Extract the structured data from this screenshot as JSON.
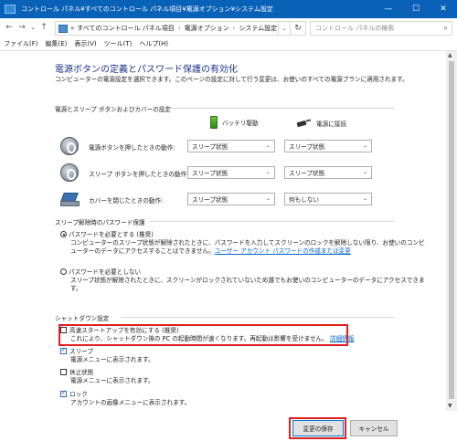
{
  "window": {
    "title": "コントロール パネル¥すべてのコントロール パネル項目¥電源オプション¥システム設定",
    "minimize": "—",
    "maximize": "☐",
    "close": "✕"
  },
  "address": {
    "back": "←",
    "forward": "→",
    "recent": "⌄",
    "up": "↑",
    "overflow": "«",
    "crumbs": [
      "すべてのコントロール パネル項目",
      "電源オプション",
      "システム設定"
    ],
    "crumb_sep": "›",
    "dropdown": "⌄",
    "refresh": "↻",
    "search_placeholder": "コントロール パネルの検索",
    "search_icon": "⌕"
  },
  "menu": [
    "ファイル(F)",
    "編集(E)",
    "表示(V)",
    "ツール(T)",
    "ヘルプ(H)"
  ],
  "page": {
    "title": "電源ボタンの定義とパスワード保護の有効化",
    "description": "コンピューターの電源設定を選択できます。このページの設定に対して行う変更は、お使いのすべての電源プランに適用されます。"
  },
  "power_section": {
    "title": "電源とスリープ ボタンおよびカバーの設定",
    "battery_label": "バッテリ駆動",
    "plugged_label": "電源に接続",
    "rows": [
      {
        "label": "電源ボタンを押したときの動作:",
        "battery": "スリープ状態",
        "plugged": "スリープ状態",
        "icon": "power-button-icon"
      },
      {
        "label": "スリープ ボタンを押したときの動作:",
        "battery": "スリープ状態",
        "plugged": "スリープ状態",
        "icon": "sleep-button-icon"
      },
      {
        "label": "カバーを閉じたときの動作:",
        "battery": "スリープ状態",
        "plugged": "何もしない",
        "icon": "laptop-lid-icon"
      }
    ],
    "chevron": "⌄"
  },
  "password_section": {
    "title": "スリープ解除時のパスワード保護",
    "option_require": "パスワードを必要とする (推奨)",
    "option_require_desc": "コンピューターのスリープ状態が解除されたときに、パスワードを入力してスクリーンのロックを解除しない限り、お使いのコンピューターのデータにアクセスすることはできません。",
    "option_require_link": "ユーザー アカウント パスワードの作成または変更",
    "option_norequire": "パスワードを必要としない",
    "option_norequire_desc": "スリープ状態が解除されたときに、スクリーンがロックされていないため誰でもお使いのコンピューターのデータにアクセスできます。"
  },
  "shutdown_section": {
    "title": "シャットダウン設定",
    "fast_startup": "高速スタートアップを有効にする (推奨)",
    "fast_startup_desc": "これにより、シャットダウン後の PC の起動時間が速くなります。再起動は影響を受けません。",
    "fast_startup_link": "詳細情報",
    "sleep": "スリープ",
    "sleep_desc": "電源メニューに表示されます。",
    "hibernate": "休止状態",
    "hibernate_desc": "電源メニューに表示されます。",
    "lock": "ロック",
    "lock_desc": "アカウントの画像メニューに表示されます。"
  },
  "footer": {
    "save": "変更の保存",
    "cancel": "キャンセル"
  },
  "scrollbar": {
    "up": "▲",
    "down": "▼"
  }
}
